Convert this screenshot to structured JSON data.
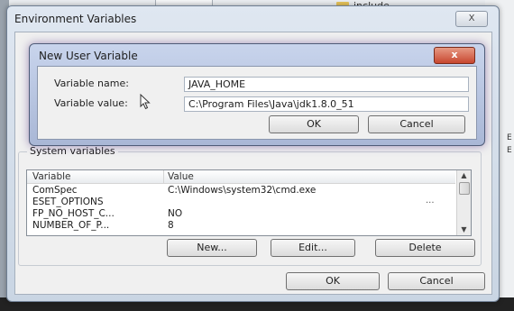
{
  "background": {
    "folder_label": "include",
    "right_edge_letters": [
      "E",
      "E"
    ]
  },
  "env_dialog": {
    "title": "Environment Variables",
    "close_glyph": "X",
    "system_group_label": "System variables",
    "columns": [
      "Variable",
      "Value"
    ],
    "rows": [
      {
        "variable": "ComSpec",
        "value": "C:\\Windows\\system32\\cmd.exe"
      },
      {
        "variable": "ESET_OPTIONS",
        "value": ""
      },
      {
        "variable": "FP_NO_HOST_C...",
        "value": "NO"
      },
      {
        "variable": "NUMBER_OF_P...",
        "value": "8"
      }
    ],
    "ellipsis": "...",
    "buttons": {
      "new": "New...",
      "edit": "Edit...",
      "delete": "Delete"
    },
    "ok": "OK",
    "cancel": "Cancel"
  },
  "new_user_variable": {
    "title": "New User Variable",
    "close_glyph": "x",
    "name_label": "Variable name:",
    "name_value": "JAVA_HOME",
    "value_label": "Variable value:",
    "value_value": "C:\\Program Files\\Java\\jdk1.8.0_51",
    "ok": "OK",
    "cancel": "Cancel"
  }
}
